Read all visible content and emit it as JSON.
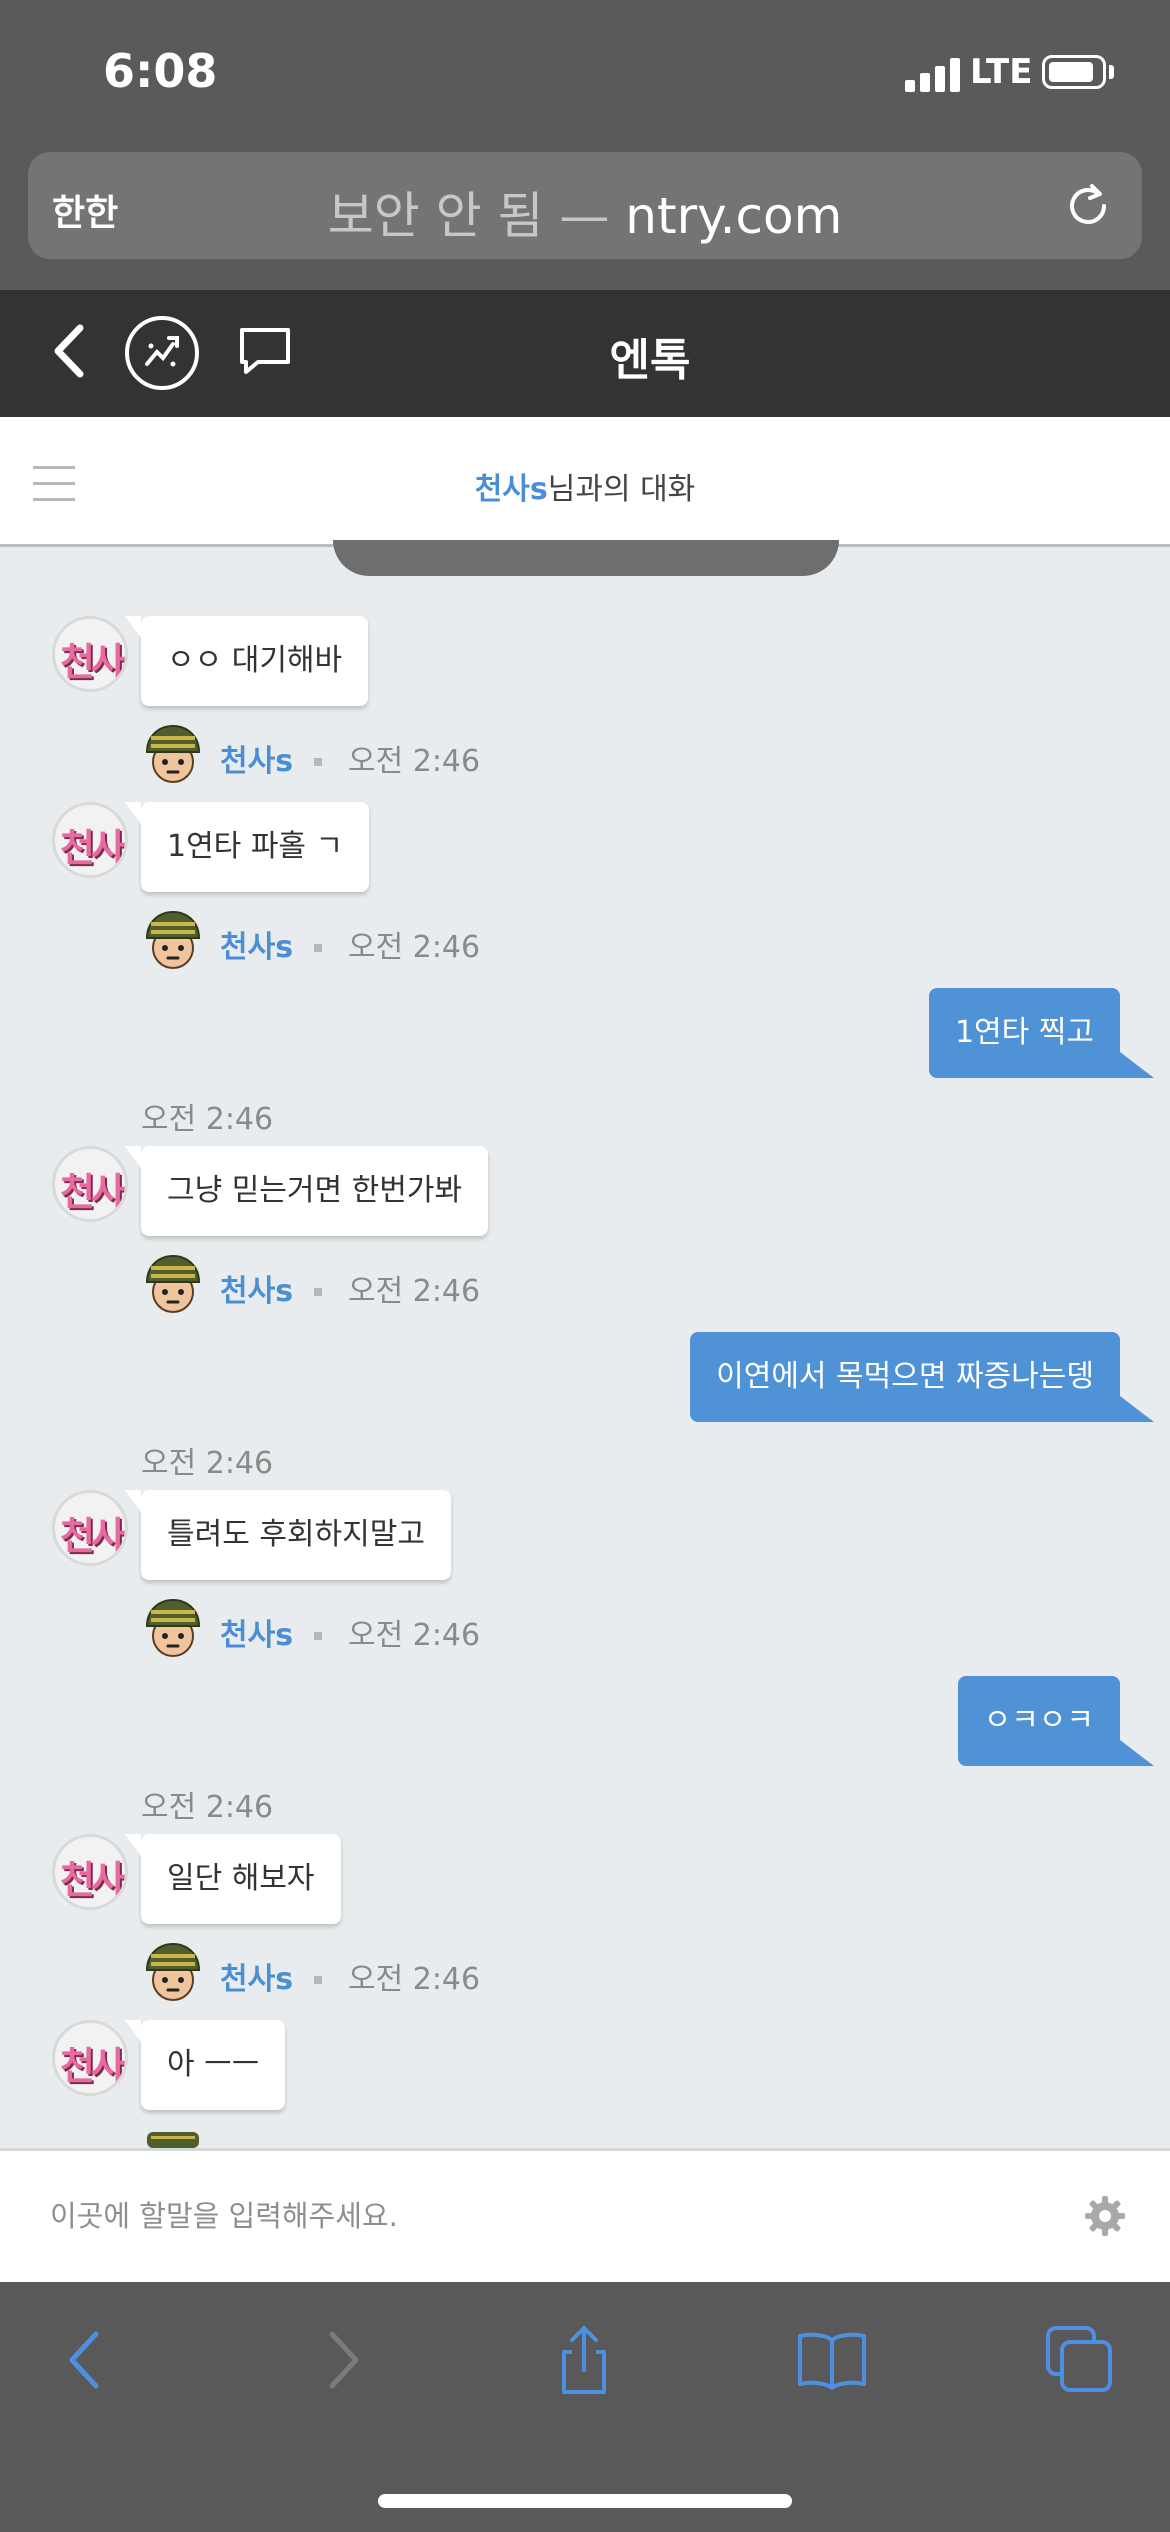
{
  "status": {
    "time": "6:08",
    "network": "LTE"
  },
  "browser": {
    "aa_label": "한한",
    "url_prefix": "보안 안 됨 —",
    "url_domain": "ntry.com",
    "toolbar": {
      "back": "back-icon",
      "forward": "forward-icon",
      "share": "share-icon",
      "bookmarks": "bookmarks-icon",
      "tabs": "tabs-icon"
    }
  },
  "app": {
    "title": "엔톡"
  },
  "conversation": {
    "partner_name": "천사s",
    "title_suffix": "님과의 대화",
    "partner_avatar_text": "천사"
  },
  "messages": [
    {
      "dir": "in",
      "text": "ㅇㅇ 대기해바",
      "name": "천사s",
      "time": "오전 2:46"
    },
    {
      "dir": "in",
      "text": "1연타 파홀 ㄱ",
      "name": "천사s",
      "time": "오전 2:46"
    },
    {
      "dir": "out",
      "text": "1연타 찍고",
      "time": "오전 2:46"
    },
    {
      "dir": "in",
      "text": "그냥 믿는거면 한번가봐",
      "name": "천사s",
      "time": "오전 2:46"
    },
    {
      "dir": "out",
      "text": "이연에서 목먹으면 짜증나는뎅",
      "time": "오전 2:46"
    },
    {
      "dir": "in",
      "text": "틀려도 후회하지말고",
      "name": "천사s",
      "time": "오전 2:46"
    },
    {
      "dir": "out",
      "text": "ㅇㅋㅇㅋ",
      "time": "오전 2:46"
    },
    {
      "dir": "in",
      "text": "일단 해보자",
      "name": "천사s",
      "time": "오전 2:46"
    },
    {
      "dir": "in",
      "text": "아 ㅡㅡ"
    }
  ],
  "input": {
    "placeholder": "이곳에 할말을 입력해주세요.",
    "settings_icon": "gear-icon"
  }
}
